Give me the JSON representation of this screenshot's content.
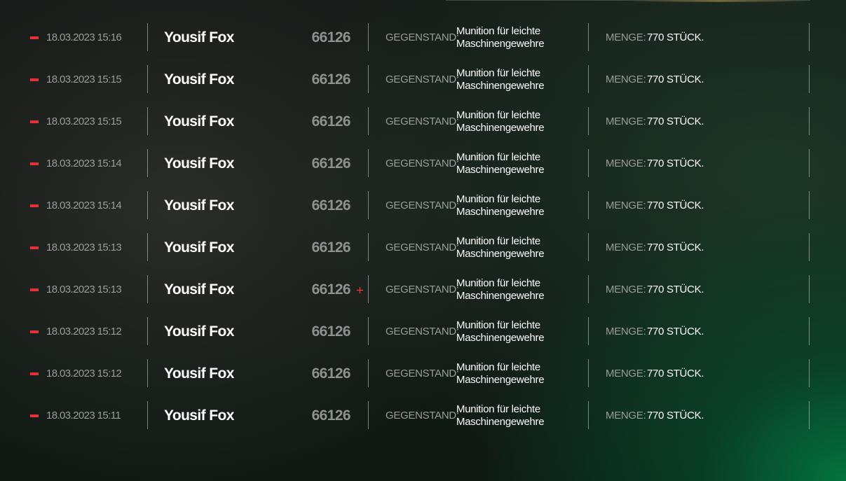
{
  "labels": {
    "item": "GEGENSTAND:",
    "quantity": "MENGE:"
  },
  "colors": {
    "marker": "#e8303a",
    "muted_text": "#9a9c9b",
    "id_text": "#8f9190",
    "accent_glow": "#00823f"
  },
  "icons": {
    "row_marker": "minus-marker-icon",
    "cursor": "crosshair-cursor-icon"
  },
  "log": [
    {
      "timestamp": "18.03.2023 15:16",
      "player": "Yousif Fox",
      "id": "66126",
      "item_line1": "Munition für leichte",
      "item_line2": "Maschinengewehre",
      "quantity": "770 STÜCK."
    },
    {
      "timestamp": "18.03.2023 15:15",
      "player": "Yousif Fox",
      "id": "66126",
      "item_line1": "Munition für leichte",
      "item_line2": "Maschinengewehre",
      "quantity": "770 STÜCK."
    },
    {
      "timestamp": "18.03.2023 15:15",
      "player": "Yousif Fox",
      "id": "66126",
      "item_line1": "Munition für leichte",
      "item_line2": "Maschinengewehre",
      "quantity": "770 STÜCK."
    },
    {
      "timestamp": "18.03.2023 15:14",
      "player": "Yousif Fox",
      "id": "66126",
      "item_line1": "Munition für leichte",
      "item_line2": "Maschinengewehre",
      "quantity": "770 STÜCK."
    },
    {
      "timestamp": "18.03.2023 15:14",
      "player": "Yousif Fox",
      "id": "66126",
      "item_line1": "Munition für leichte",
      "item_line2": "Maschinengewehre",
      "quantity": "770 STÜCK."
    },
    {
      "timestamp": "18.03.2023 15:13",
      "player": "Yousif Fox",
      "id": "66126",
      "item_line1": "Munition für leichte",
      "item_line2": "Maschinengewehre",
      "quantity": "770 STÜCK."
    },
    {
      "timestamp": "18.03.2023 15:13",
      "player": "Yousif Fox",
      "id": "66126",
      "item_line1": "Munition für leichte",
      "item_line2": "Maschinengewehre",
      "quantity": "770 STÜCK."
    },
    {
      "timestamp": "18.03.2023 15:12",
      "player": "Yousif Fox",
      "id": "66126",
      "item_line1": "Munition für leichte",
      "item_line2": "Maschinengewehre",
      "quantity": "770 STÜCK."
    },
    {
      "timestamp": "18.03.2023 15:12",
      "player": "Yousif Fox",
      "id": "66126",
      "item_line1": "Munition für leichte",
      "item_line2": "Maschinengewehre",
      "quantity": "770 STÜCK."
    },
    {
      "timestamp": "18.03.2023 15:11",
      "player": "Yousif Fox",
      "id": "66126",
      "item_line1": "Munition für leichte",
      "item_line2": "Maschinengewehre",
      "quantity": "770 STÜCK."
    }
  ]
}
